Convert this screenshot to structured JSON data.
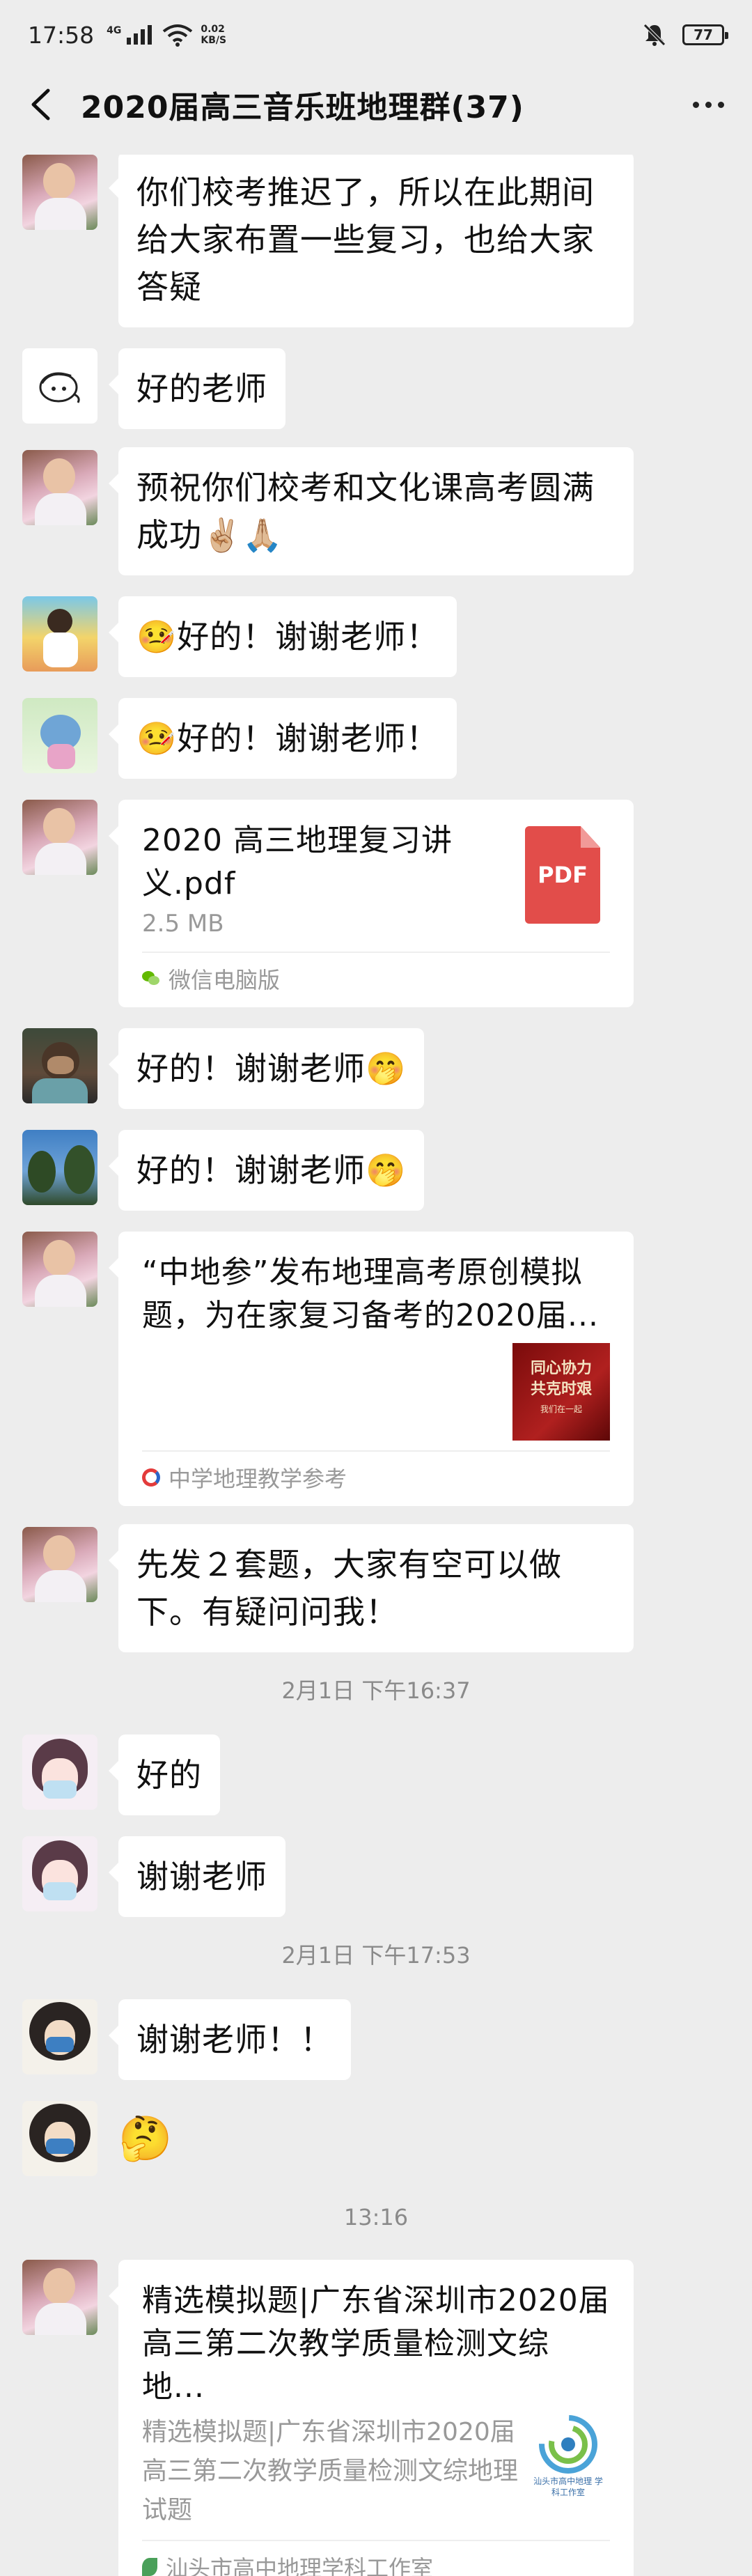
{
  "status_bar": {
    "time": "17:58",
    "network": "4G",
    "speed_value": "0.02",
    "speed_unit": "KB/S",
    "battery": "77"
  },
  "header": {
    "title": "2020届高三音乐班地理群(37)"
  },
  "messages": [
    {
      "type": "text",
      "text": "你们校考推迟了，所以在此期间给大家布置一些复习，也给大家答疑"
    },
    {
      "type": "text",
      "text": "好的老师"
    },
    {
      "type": "text",
      "text": "预祝你们校考和文化课高考圆满成功✌🏼🙏🏼"
    },
    {
      "type": "text",
      "text": "🤒好的！谢谢老师！"
    },
    {
      "type": "text",
      "text": "🤒好的！谢谢老师！"
    },
    {
      "type": "file",
      "name": "2020 高三地理复习讲义.pdf",
      "size": "2.5 MB",
      "icon_label": "PDF",
      "source": "微信电脑版"
    },
    {
      "type": "text",
      "text": "好的！谢谢老师🤭"
    },
    {
      "type": "text",
      "text": "好的！谢谢老师🤭"
    },
    {
      "type": "link",
      "title": "“中地参”发布地理高考原创模拟题，为在家复习备考的2020届...",
      "thumb_text": "同心协力 共克时艰",
      "thumb_small": "我们在一起",
      "source": "中学地理教学参考"
    },
    {
      "type": "text",
      "text": "先发２套题，大家有空可以做下。有疑问问我！"
    },
    {
      "type": "time",
      "text": "2月1日 下午16:37"
    },
    {
      "type": "text",
      "text": "好的"
    },
    {
      "type": "text",
      "text": "谢谢老师"
    },
    {
      "type": "time",
      "text": "2月1日 下午17:53"
    },
    {
      "type": "text",
      "text": "谢谢老师！！"
    },
    {
      "type": "emoji",
      "text": "🤔"
    },
    {
      "type": "time",
      "text": "13:16"
    },
    {
      "type": "link",
      "title": "精选模拟题|广东省深圳市2020届高三第二次教学质量检测文综地...",
      "desc": "精选模拟题|广东省深圳市2020届高三第二次教学质量检测文综地理试题",
      "thumb_text": "汕头市高中地理 学科工作室",
      "source": "汕头市高中地理学科工作室"
    }
  ],
  "colors": {
    "background": "#ededed",
    "bubble": "#ffffff",
    "pdf_red": "#e24d4a",
    "timestamp_gray": "#8a8a8a"
  }
}
